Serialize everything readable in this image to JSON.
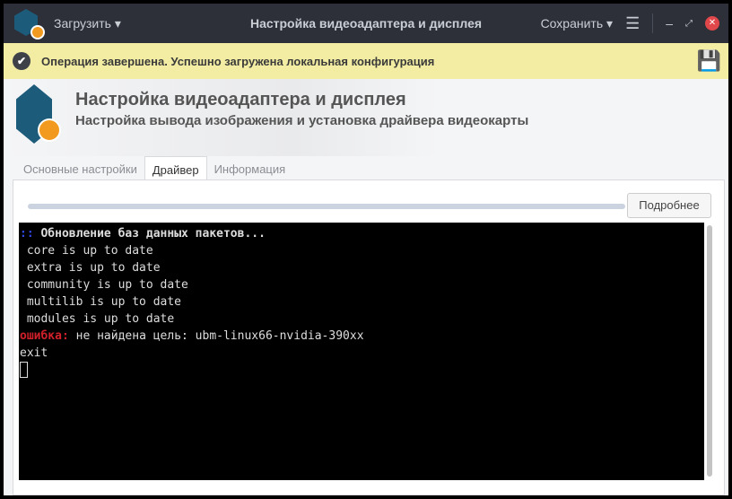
{
  "titlebar": {
    "load_label": "Загрузить",
    "title": "Настройка видеоадаптера и дисплея",
    "save_label": "Сохранить"
  },
  "notice": {
    "text": "Операция завершена. Успешно загружена локальная конфигурация"
  },
  "header": {
    "title": "Настройка видеоадаптера и дисплея",
    "subtitle": "Настройка вывода изображения и установка драйвера видеокарты"
  },
  "tabs": [
    {
      "label": "Основные настройки"
    },
    {
      "label": "Драйвер"
    },
    {
      "label": "Информация"
    }
  ],
  "panel": {
    "more_label": "Подробнее",
    "progress": 1.0
  },
  "terminal": {
    "prefix": "::",
    "heading": " Обновление баз данных пакетов...",
    "lines": [
      " core is up to date",
      " extra is up to date",
      " community is up to date",
      " multilib is up to date",
      " modules is up to date"
    ],
    "error_label": "ошибка:",
    "error_text": " не найдена цель: ubm-linux66-nvidia-390xx",
    "exit": "exit"
  }
}
